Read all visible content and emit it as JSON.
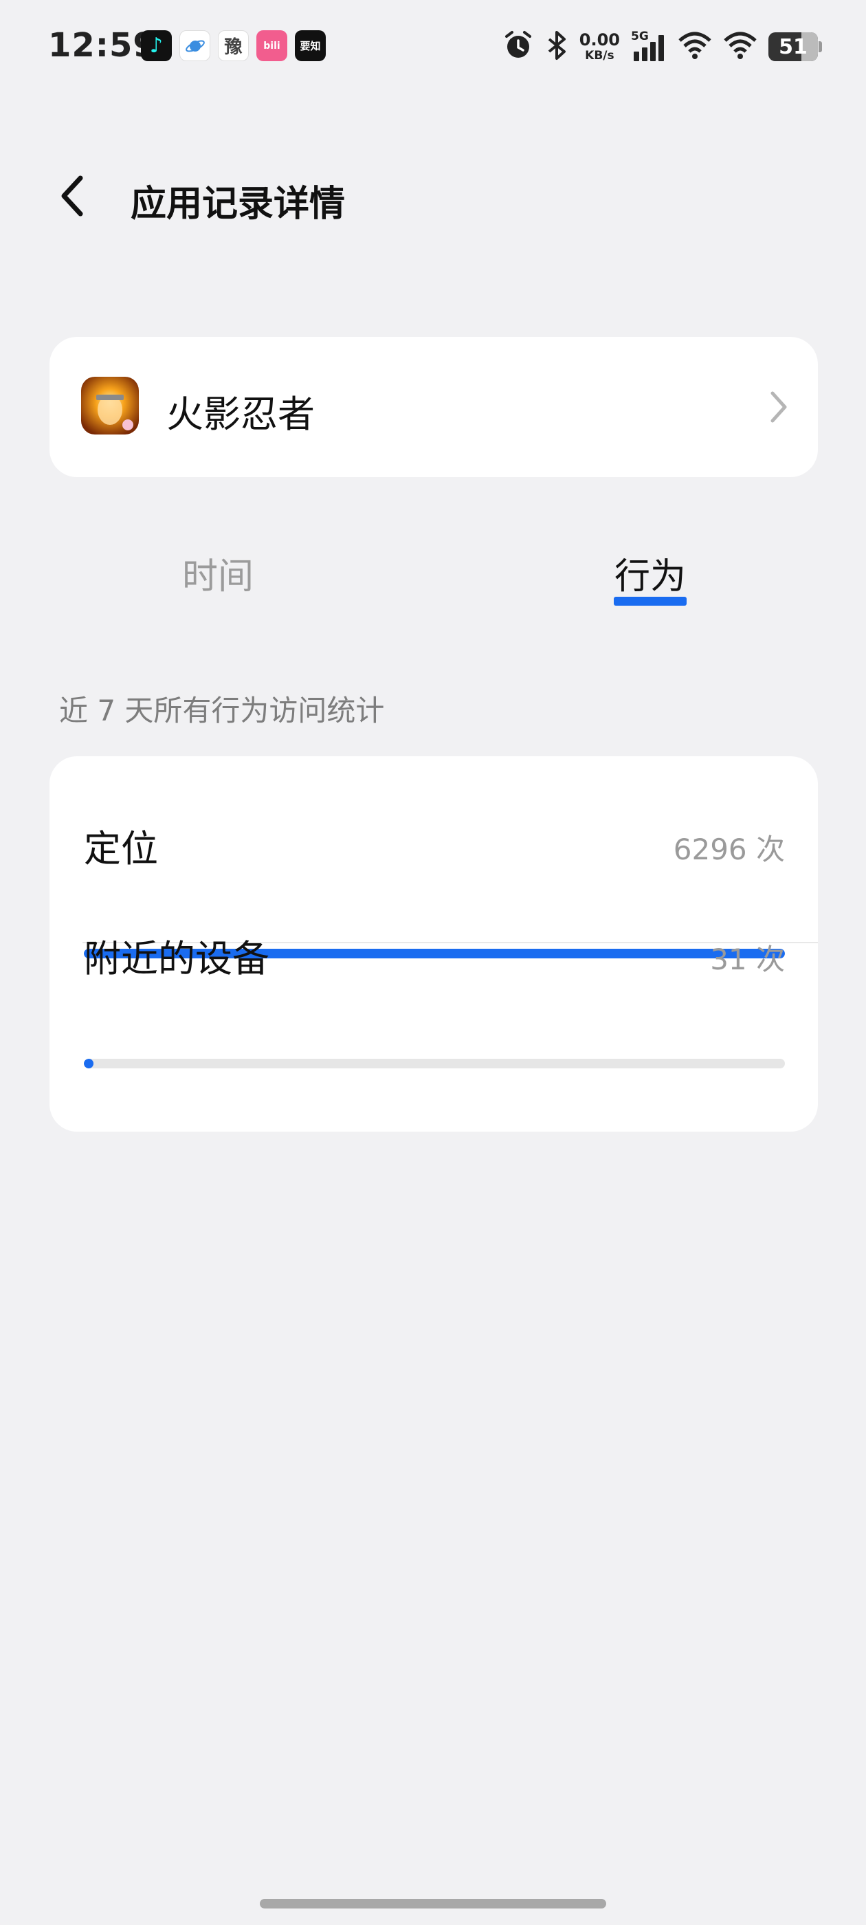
{
  "status_bar": {
    "time": "12:59",
    "notification_apps": [
      {
        "icon": "tiktok-icon",
        "glyph": "♪"
      },
      {
        "icon": "planet-browser-icon",
        "glyph": "🪐"
      },
      {
        "icon": "calligraphy-app-icon",
        "glyph": "豫"
      },
      {
        "icon": "bilibili-icon",
        "glyph": "bili"
      },
      {
        "icon": "zhihu-icon",
        "glyph": "要知"
      }
    ],
    "net_speed_value": "0.00",
    "net_speed_unit": "KB/s",
    "network_type": "5G",
    "battery_level": "51",
    "icons": [
      "alarm-icon",
      "bluetooth-icon",
      "cellular-signal-icon",
      "wifi-icon",
      "wifi-icon",
      "battery-icon"
    ]
  },
  "header": {
    "title": "应用记录详情",
    "back_icon": "chevron-left-icon"
  },
  "app": {
    "name": "火影忍者",
    "icon": "naruto-app-icon",
    "chevron_icon": "chevron-right-icon"
  },
  "tabs": [
    {
      "label": "时间",
      "active": false
    },
    {
      "label": "行为",
      "active": true
    }
  ],
  "section_label": "近 7 天所有行为访问统计",
  "stats": [
    {
      "name": "定位",
      "count": "6296 次",
      "fraction": 1.0
    },
    {
      "name": "附近的设备",
      "count": "31 次",
      "fraction": 0.005
    }
  ],
  "colors": {
    "accent": "#1a6cf0",
    "background": "#f1f1f3",
    "card": "#ffffff",
    "muted_text": "#9b9b9b"
  }
}
